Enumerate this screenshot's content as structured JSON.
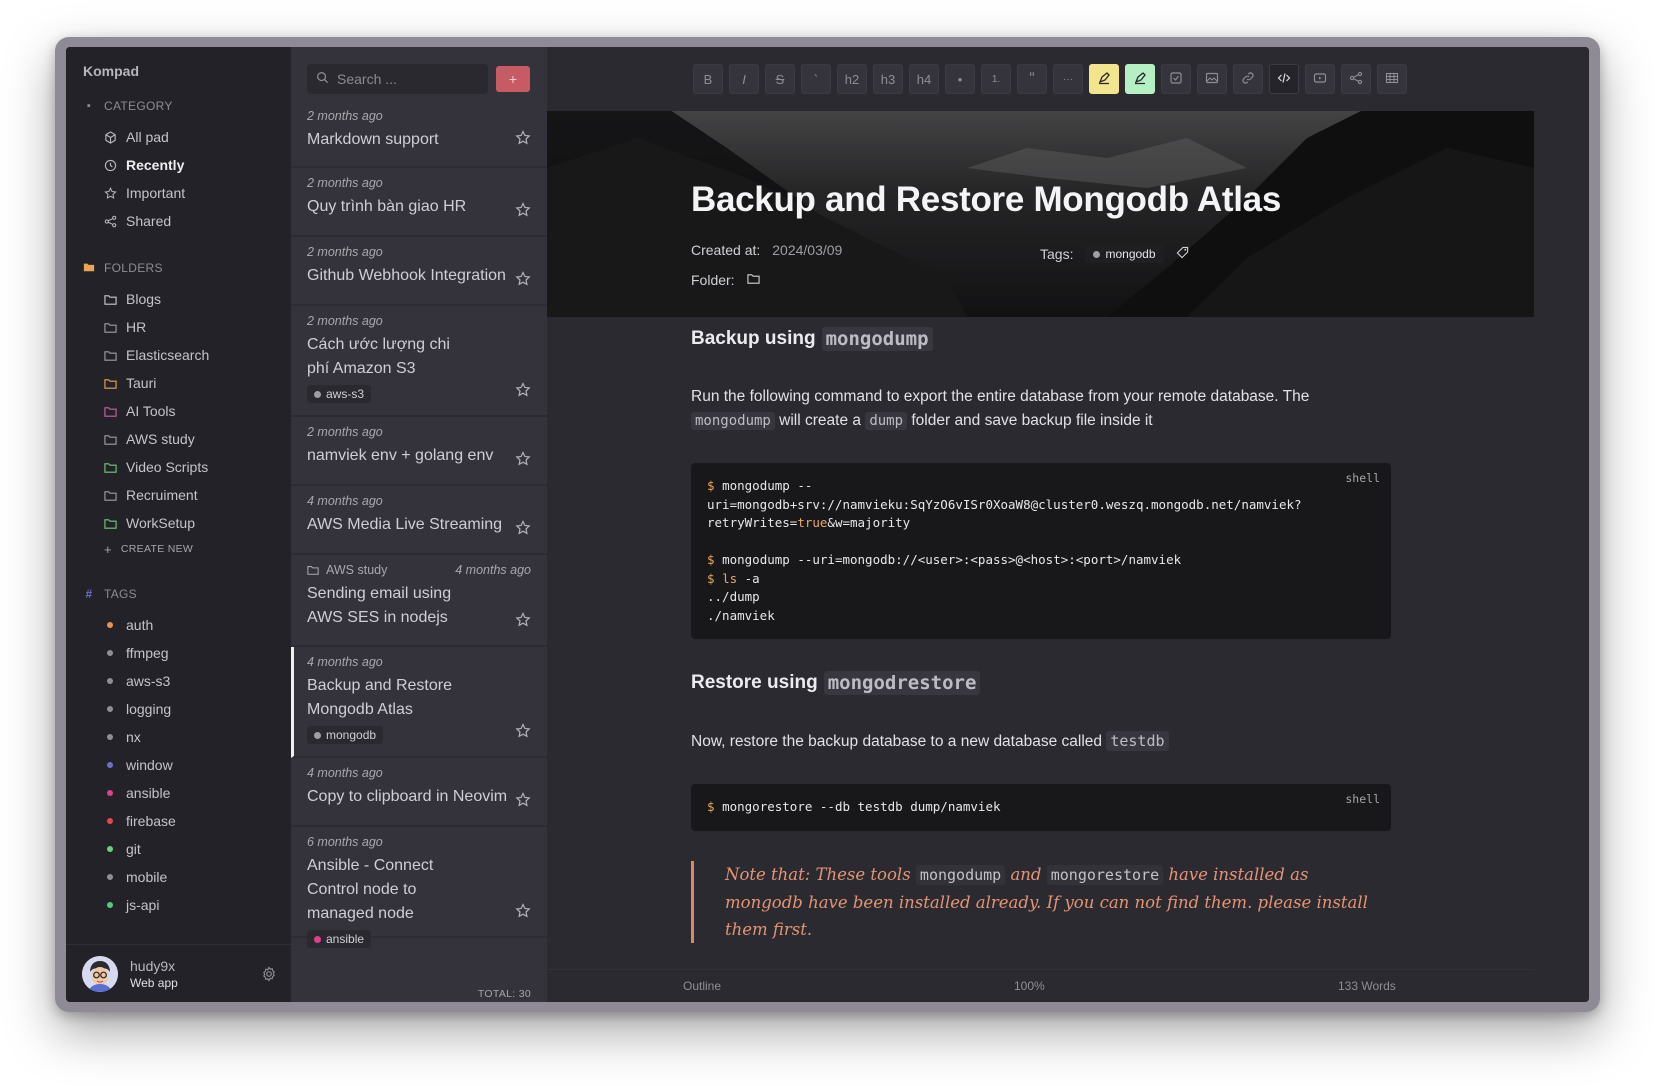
{
  "app": {
    "brand": "Kompad"
  },
  "sidebar": {
    "category_heading": "CATEGORY",
    "categories": [
      {
        "label": "All pad",
        "icon": "all-pad-icon"
      },
      {
        "label": "Recently",
        "icon": "clock-icon"
      },
      {
        "label": "Important",
        "icon": "star-icon"
      },
      {
        "label": "Shared",
        "icon": "share-icon"
      }
    ],
    "folders_heading": "FOLDERS",
    "folders": [
      {
        "label": "Blogs",
        "color": "#c9c9cf"
      },
      {
        "label": "HR",
        "color": "#9f9ea6"
      },
      {
        "label": "Elasticsearch",
        "color": "#9f9ea6"
      },
      {
        "label": "Tauri",
        "color": "#e8a554"
      },
      {
        "label": "AI Tools",
        "color": "#d35ea8"
      },
      {
        "label": "AWS study",
        "color": "#9f9ea6"
      },
      {
        "label": "Video Scripts",
        "color": "#6fcf7a"
      },
      {
        "label": "Recruiment",
        "color": "#9f9ea6"
      },
      {
        "label": "WorkSetup",
        "color": "#6fcf7a"
      }
    ],
    "create_new": "CREATE NEW",
    "tags_heading": "TAGS",
    "tags": [
      {
        "label": "auth",
        "color": "#e89457"
      },
      {
        "label": "ffmpeg",
        "color": "#8f8e96"
      },
      {
        "label": "aws-s3",
        "color": "#8f8e96"
      },
      {
        "label": "logging",
        "color": "#8f8e96"
      },
      {
        "label": "nx",
        "color": "#8f8e96"
      },
      {
        "label": "window",
        "color": "#6b70c9"
      },
      {
        "label": "ansible",
        "color": "#e0408d"
      },
      {
        "label": "firebase",
        "color": "#e04a4a"
      },
      {
        "label": "git",
        "color": "#6fcf7a"
      },
      {
        "label": "mobile",
        "color": "#8f8e96"
      },
      {
        "label": "js-api",
        "color": "#59c97e"
      }
    ],
    "user": {
      "name": "hudy9x",
      "subtitle": "Web app"
    }
  },
  "notelist": {
    "search_placeholder": "Search ...",
    "add_label": "+",
    "total": "TOTAL: 30",
    "notes": [
      {
        "time": "2 months ago",
        "title": "Markdown support"
      },
      {
        "time": "2 months ago",
        "title": "Quy trình bàn giao HR"
      },
      {
        "time": "2 months ago",
        "title": "Github Webhook Integration"
      },
      {
        "time": "2 months ago",
        "title": "Cách ước lượng chi phí Amazon S3",
        "tag": "aws-s3",
        "tag_color": "#9f9ea6"
      },
      {
        "time": "2 months ago",
        "title": "namviek env + golang env"
      },
      {
        "time": "4 months ago",
        "title": "AWS Media Live Streaming"
      },
      {
        "time": "4 months ago",
        "title": "Sending email using AWS SES in nodejs",
        "folder": "AWS study"
      },
      {
        "time": "4 months ago",
        "title": "Backup and Restore Mongodb Atlas",
        "tag": "mongodb",
        "tag_color": "#9f9ea6",
        "selected": true
      },
      {
        "time": "4 months ago",
        "title": "Copy to clipboard in Neovim"
      },
      {
        "time": "6 months ago",
        "title": "Ansible - Connect Control node to managed node",
        "tag": "ansible",
        "tag_color": "#e0408d"
      }
    ]
  },
  "toolbar": {
    "buttons": [
      {
        "label": "B",
        "name": "bold-button"
      },
      {
        "label": "I",
        "name": "italic-button"
      },
      {
        "label": "S",
        "name": "strikethrough-button"
      },
      {
        "label": "`",
        "name": "inline-code-button"
      },
      {
        "label": "h2",
        "name": "heading2-button"
      },
      {
        "label": "h3",
        "name": "heading3-button"
      },
      {
        "label": "h4",
        "name": "heading4-button"
      },
      {
        "label": "•",
        "name": "bullet-list-button"
      },
      {
        "label": "1.",
        "name": "ordered-list-button"
      },
      {
        "label": "“",
        "name": "blockquote-button"
      },
      {
        "label": "···",
        "name": "more-button"
      }
    ]
  },
  "editor": {
    "title": "Backup and Restore Mongodb Atlas",
    "created_label": "Created at:",
    "created_value": "2024/03/09",
    "folder_label": "Folder:",
    "tags_label": "Tags:",
    "tag": "mongodb",
    "section1_heading": "Backup using",
    "section1_code": "mongodump",
    "para1_a": "Run the following command to export the entire database from your remote database. The",
    "para1_code1": "mongodump",
    "para1_b": "will create a",
    "para1_code2": "dump",
    "para1_c": "folder and save backup file inside it",
    "codeblock1_lang": "shell",
    "codeblock1": [
      "mongodump --",
      "uri=mongodb+srv://namvieku:SqYzO6vISr0XoaW8@cluster0.weszq.mongodb.net/namviek?",
      "retryWrites=",
      "true",
      "&w=majority",
      "mongodump --uri=mongodb://<user>:<pass>@<host>:<port>/namviek",
      "ls",
      " -a",
      "../dump",
      "./namviek"
    ],
    "section2_heading": "Restore using",
    "section2_code": "mongodrestore",
    "para2": "Now, restore the backup database to a new database called",
    "para2_code": "testdb",
    "codeblock2_lang": "shell",
    "codeblock2": "mongorestore --db testdb dump/namviek",
    "quote_a": "Note that: These tools",
    "quote_code1": "mongodump",
    "quote_b": "and",
    "quote_code2": "mongorestore",
    "quote_c": "have installed as mongodb have been installed already. If you can not find them. please install them first.",
    "prompt": "$"
  },
  "statusbar": {
    "outline": "Outline",
    "zoom": "100%",
    "words": "133 Words"
  }
}
